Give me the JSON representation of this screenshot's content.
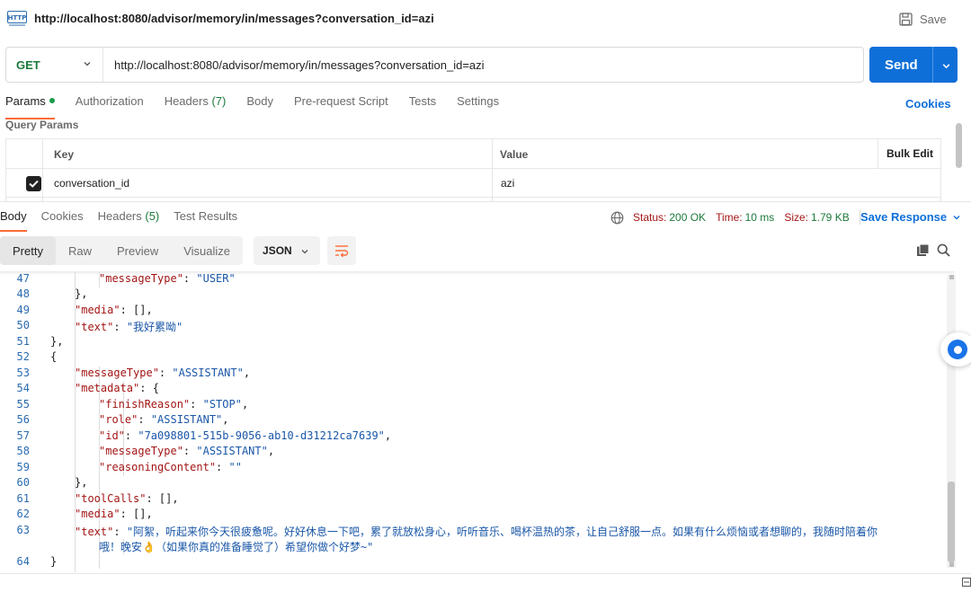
{
  "tab": {
    "icon": "http-icon",
    "title": "http://localhost:8080/advisor/memory/in/messages?conversation_id=azi",
    "save_label": "Save"
  },
  "request": {
    "method": "GET",
    "url": "http://localhost:8080/advisor/memory/in/messages?conversation_id=azi",
    "send_label": "Send"
  },
  "request_tabs": {
    "params": "Params",
    "authorization": "Authorization",
    "headers": "Headers",
    "headers_count": "(7)",
    "body": "Body",
    "prerequest": "Pre-request Script",
    "tests": "Tests",
    "settings": "Settings",
    "cookies": "Cookies"
  },
  "query_params": {
    "label": "Query Params",
    "columns": {
      "key": "Key",
      "value": "Value",
      "bulk_edit": "Bulk Edit"
    },
    "rows": [
      {
        "checked": true,
        "key": "conversation_id",
        "value": "azi"
      }
    ]
  },
  "response": {
    "tabs": {
      "body": "Body",
      "cookies": "Cookies",
      "headers": "Headers",
      "headers_count": "(5)",
      "test_results": "Test Results"
    },
    "status_label": "Status:",
    "status": "200 OK",
    "time_label": "Time:",
    "time": "10 ms",
    "size_label": "Size:",
    "size": "1.79 KB",
    "save_response": "Save Response",
    "views": {
      "pretty": "Pretty",
      "raw": "Raw",
      "preview": "Preview",
      "visualize": "Visualize"
    },
    "format": "JSON"
  },
  "code": {
    "line_numbers": [
      "47",
      "48",
      "49",
      "50",
      "51",
      "52",
      "53",
      "54",
      "55",
      "56",
      "57",
      "58",
      "59",
      "60",
      "61",
      "62",
      "63",
      "64"
    ],
    "lines": [
      {
        "indent": 3,
        "parts": [
          [
            "k",
            "\"messageType\""
          ],
          [
            "p",
            ": "
          ],
          [
            "s",
            "\"USER\""
          ]
        ]
      },
      {
        "indent": 2,
        "parts": [
          [
            "p",
            "},"
          ]
        ]
      },
      {
        "indent": 2,
        "parts": [
          [
            "k",
            "\"media\""
          ],
          [
            "p",
            ": [],"
          ]
        ]
      },
      {
        "indent": 2,
        "parts": [
          [
            "k",
            "\"text\""
          ],
          [
            "p",
            ": "
          ],
          [
            "s",
            "\"我好累呦\""
          ]
        ]
      },
      {
        "indent": 1,
        "parts": [
          [
            "p",
            "},"
          ]
        ]
      },
      {
        "indent": 1,
        "parts": [
          [
            "p",
            "{"
          ]
        ]
      },
      {
        "indent": 2,
        "parts": [
          [
            "k",
            "\"messageType\""
          ],
          [
            "p",
            ": "
          ],
          [
            "s",
            "\"ASSISTANT\""
          ],
          [
            "p",
            ","
          ]
        ]
      },
      {
        "indent": 2,
        "parts": [
          [
            "k",
            "\"metadata\""
          ],
          [
            "p",
            ": {"
          ]
        ]
      },
      {
        "indent": 3,
        "parts": [
          [
            "k",
            "\"finishReason\""
          ],
          [
            "p",
            ": "
          ],
          [
            "s",
            "\"STOP\""
          ],
          [
            "p",
            ","
          ]
        ]
      },
      {
        "indent": 3,
        "parts": [
          [
            "k",
            "\"role\""
          ],
          [
            "p",
            ": "
          ],
          [
            "s",
            "\"ASSISTANT\""
          ],
          [
            "p",
            ","
          ]
        ]
      },
      {
        "indent": 3,
        "parts": [
          [
            "k",
            "\"id\""
          ],
          [
            "p",
            ": "
          ],
          [
            "s",
            "\"7a098801-515b-9056-ab10-d31212ca7639\""
          ],
          [
            "p",
            ","
          ]
        ]
      },
      {
        "indent": 3,
        "parts": [
          [
            "k",
            "\"messageType\""
          ],
          [
            "p",
            ": "
          ],
          [
            "s",
            "\"ASSISTANT\""
          ],
          [
            "p",
            ","
          ]
        ]
      },
      {
        "indent": 3,
        "parts": [
          [
            "k",
            "\"reasoningContent\""
          ],
          [
            "p",
            ": "
          ],
          [
            "s",
            "\"\""
          ]
        ]
      },
      {
        "indent": 2,
        "parts": [
          [
            "p",
            "},"
          ]
        ]
      },
      {
        "indent": 2,
        "parts": [
          [
            "k",
            "\"toolCalls\""
          ],
          [
            "p",
            ": [],"
          ]
        ]
      },
      {
        "indent": 2,
        "parts": [
          [
            "k",
            "\"media\""
          ],
          [
            "p",
            ": [],"
          ]
        ]
      },
      {
        "indent": 2,
        "parts": [
          [
            "k",
            "\"text\""
          ],
          [
            "p",
            ": "
          ],
          [
            "s",
            "\"阿絮，听起来你今天很疲惫呢。好好休息一下吧，累了就放松身心，听听音乐、喝杯温热的茶，让自己舒服一点。如果有什么烦恼或者想聊的，我随时陪着你"
          ]
        ]
      },
      {
        "indent": 3,
        "parts": [
          [
            "s",
            "哦！晚安👌（如果你真的准备睡觉了）希望你做个好梦~\""
          ]
        ]
      },
      {
        "indent": 1,
        "parts": [
          [
            "p",
            "}"
          ]
        ]
      }
    ]
  },
  "colors": {
    "accent": "#0f6fd8",
    "tab_underline": "#ff6c37",
    "status_ok": "#1b7a3b",
    "method_get": "#1b7a3b",
    "json_key": "#a31515",
    "json_string": "#1a57a8",
    "line_number": "#2b6cb0"
  }
}
